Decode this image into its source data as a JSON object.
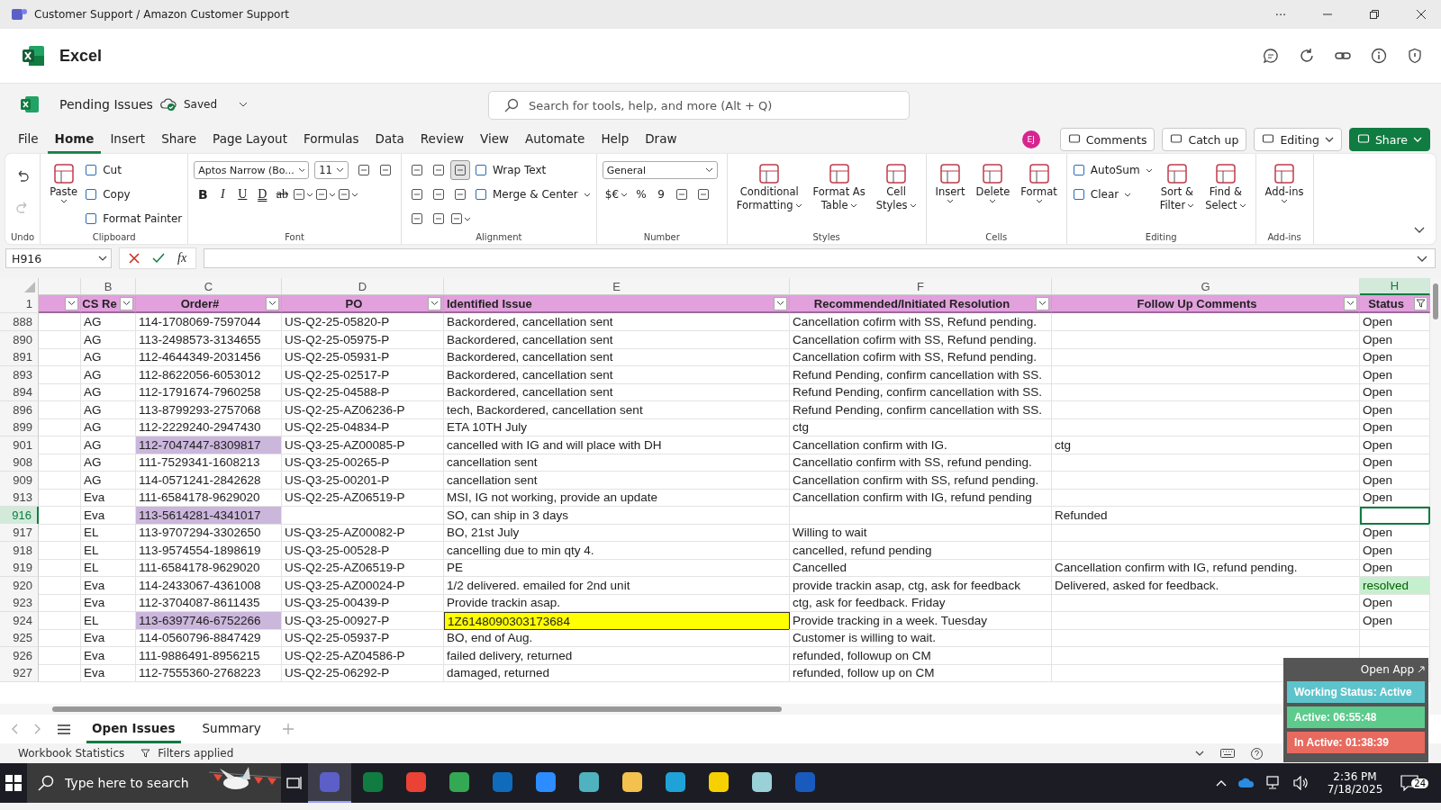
{
  "title_bar": {
    "title": "Customer Support / Amazon Customer Support",
    "more": "···"
  },
  "app": {
    "name": "Excel"
  },
  "document": {
    "name": "Pending Issues",
    "save_state": "Saved"
  },
  "search": {
    "placeholder": "Search for tools, help, and more (Alt + Q)"
  },
  "menu_tabs": [
    {
      "label": "File",
      "selected": false
    },
    {
      "label": "Home",
      "selected": true
    },
    {
      "label": "Insert",
      "selected": false
    },
    {
      "label": "Share",
      "selected": false
    },
    {
      "label": "Page Layout",
      "selected": false
    },
    {
      "label": "Formulas",
      "selected": false
    },
    {
      "label": "Data",
      "selected": false
    },
    {
      "label": "Review",
      "selected": false
    },
    {
      "label": "View",
      "selected": false
    },
    {
      "label": "Automate",
      "selected": false
    },
    {
      "label": "Help",
      "selected": false
    },
    {
      "label": "Draw",
      "selected": false
    }
  ],
  "user": {
    "initials": "EJ"
  },
  "actions": [
    {
      "label": "Comments",
      "kind": "plain"
    },
    {
      "label": "Catch up",
      "kind": "plain"
    },
    {
      "label": "Editing",
      "kind": "menu"
    },
    {
      "label": "Share",
      "kind": "primary"
    }
  ],
  "ribbon": [
    {
      "label": "Undo",
      "columns": [
        [
          {
            "kind": "icon",
            "disabled": false
          },
          {
            "kind": "icon",
            "disabled": true
          }
        ]
      ]
    },
    {
      "label": "Clipboard",
      "columns": [
        [
          {
            "kind": "large",
            "lines": [
              "Paste"
            ],
            "menu": true
          }
        ],
        [
          {
            "kind": "row",
            "label": "Cut"
          },
          {
            "kind": "row",
            "label": "Copy"
          },
          {
            "kind": "row",
            "label": "Format Painter"
          }
        ]
      ]
    },
    {
      "label": "Font",
      "columns": [
        [
          {
            "kind": "strip",
            "items": [
              {
                "kind": "dropdown",
                "label": "Aptos Narrow (Bo...",
                "wide": true
              },
              {
                "kind": "dropdown",
                "label": "11",
                "wide": false
              },
              {
                "kind": "icon"
              },
              {
                "kind": "icon"
              }
            ]
          },
          {
            "kind": "strip",
            "items": [
              {
                "kind": "bold",
                "label": "B"
              },
              {
                "kind": "italic",
                "label": "I"
              },
              {
                "kind": "underline",
                "label": "U"
              },
              {
                "kind": "double",
                "label": "D"
              },
              {
                "kind": "strike",
                "label": "ab"
              },
              {
                "kind": "icon",
                "menu": true
              },
              {
                "kind": "icon",
                "menu": true
              },
              {
                "kind": "icon",
                "menu": true
              }
            ]
          }
        ]
      ]
    },
    {
      "label": "Alignment",
      "columns": [
        [
          {
            "kind": "strip",
            "items": [
              {
                "kind": "icon",
                "selected": false
              },
              {
                "kind": "icon",
                "selected": false
              },
              {
                "kind": "icon",
                "selected": true
              }
            ]
          },
          {
            "kind": "strip",
            "items": [
              {
                "kind": "icon"
              },
              {
                "kind": "icon"
              },
              {
                "kind": "icon"
              }
            ]
          },
          {
            "kind": "strip",
            "items": [
              {
                "kind": "icon"
              },
              {
                "kind": "icon"
              },
              {
                "kind": "icon",
                "menu": true
              }
            ]
          }
        ],
        [
          {
            "kind": "row",
            "label": "Wrap Text"
          },
          {
            "kind": "row",
            "label": "Merge & Center",
            "menu": true
          }
        ]
      ]
    },
    {
      "label": "Number",
      "columns": [
        [
          {
            "kind": "strip",
            "items": [
              {
                "kind": "dropdown",
                "label": "General",
                "wide": true
              }
            ]
          },
          {
            "kind": "strip",
            "items": [
              {
                "kind": "glyph",
                "label": "$€",
                "menu": true
              },
              {
                "kind": "glyph",
                "label": "%"
              },
              {
                "kind": "glyph",
                "label": "9"
              },
              {
                "kind": "icon"
              },
              {
                "kind": "icon"
              }
            ]
          }
        ]
      ]
    },
    {
      "label": "Styles",
      "columns": [
        [
          {
            "kind": "large",
            "lines": [
              "Conditional",
              "Formatting"
            ],
            "menu": true
          }
        ],
        [
          {
            "kind": "large",
            "lines": [
              "Format As",
              "Table"
            ],
            "menu": true
          }
        ],
        [
          {
            "kind": "large",
            "lines": [
              "Cell",
              "Styles"
            ],
            "menu": true
          }
        ]
      ]
    },
    {
      "label": "Cells",
      "columns": [
        [
          {
            "kind": "large",
            "lines": [
              "Insert"
            ],
            "menu": true
          }
        ],
        [
          {
            "kind": "large",
            "lines": [
              "Delete"
            ],
            "menu": true
          }
        ],
        [
          {
            "kind": "large",
            "lines": [
              "Format"
            ],
            "menu": true
          }
        ]
      ]
    },
    {
      "label": "Editing",
      "columns": [
        [
          {
            "kind": "row",
            "label": "AutoSum",
            "menu": true
          },
          {
            "kind": "row",
            "label": "Clear",
            "menu": true
          }
        ],
        [
          {
            "kind": "large",
            "lines": [
              "Sort &",
              "Filter"
            ],
            "menu": true
          }
        ],
        [
          {
            "kind": "large",
            "lines": [
              "Find &",
              "Select"
            ],
            "menu": true
          }
        ]
      ]
    },
    {
      "label": "Add-ins",
      "columns": [
        [
          {
            "kind": "large",
            "lines": [
              "Add-ins"
            ],
            "menu": true
          }
        ]
      ]
    }
  ],
  "formula_bar": {
    "cell": "H916",
    "fx": "fx"
  },
  "sheet": {
    "columns": [
      {
        "selected": false
      },
      {
        "letter": "B",
        "selected": false
      },
      {
        "letter": "C",
        "selected": false
      },
      {
        "letter": "D",
        "selected": false
      },
      {
        "letter": "E",
        "selected": false
      },
      {
        "letter": "F",
        "selected": false
      },
      {
        "letter": "G",
        "selected": false
      },
      {
        "letter": "H",
        "selected": true
      }
    ],
    "header_row": "1",
    "header": [
      {
        "filter_applied": false
      },
      {
        "label": "CS Re",
        "filter_applied": false
      },
      {
        "label": "Order#",
        "filter_applied": false
      },
      {
        "label": "PO",
        "filter_applied": false
      },
      {
        "label": "Identified Issue",
        "filter_applied": false
      },
      {
        "label": "Recommended/Initiated Resolution",
        "filter_applied": false
      },
      {
        "label": "Follow Up Comments",
        "filter_applied": false
      },
      {
        "label": "Status",
        "filter_applied": true
      }
    ],
    "rows": [
      {
        "num": "888",
        "selected": false,
        "cells": {
          "b": "AG",
          "c": "114-1708069-7597044",
          "d": "US-Q2-25-05820-P",
          "e": "Backordered, cancellation sent",
          "f": "Cancellation cofirm with SS, Refund pending.",
          "h": "Open"
        }
      },
      {
        "num": "890",
        "selected": false,
        "cells": {
          "b": "AG",
          "c": "113-2498573-3134655",
          "d": "US-Q2-25-05975-P",
          "e": "Backordered, cancellation sent",
          "f": "Cancellation cofirm with SS, Refund pending.",
          "h": "Open"
        }
      },
      {
        "num": "891",
        "selected": false,
        "cells": {
          "b": "AG",
          "c": "112-4644349-2031456",
          "d": "US-Q2-25-05931-P",
          "e": "Backordered, cancellation sent",
          "f": "Cancellation cofirm with SS, Refund pending.",
          "h": "Open"
        }
      },
      {
        "num": "893",
        "selected": false,
        "cells": {
          "b": "AG",
          "c": "112-8622056-6053012",
          "d": "US-Q2-25-02517-P",
          "e": "Backordered, cancellation sent",
          "f": "Refund Pending, confirm cancellation with SS.",
          "h": "Open"
        }
      },
      {
        "num": "894",
        "selected": false,
        "cells": {
          "b": "AG",
          "c": "112-1791674-7960258",
          "d": "US-Q2-25-04588-P",
          "e": "Backordered, cancellation sent",
          "f": "Refund Pending, confirm cancellation with SS.",
          "h": "Open"
        }
      },
      {
        "num": "896",
        "selected": false,
        "cells": {
          "b": "AG",
          "c": "113-8799293-2757068",
          "d": "US-Q2-25-AZ06236-P",
          "e": "tech, Backordered, cancellation sent",
          "f": "Refund Pending, confirm cancellation with SS.",
          "h": "Open"
        }
      },
      {
        "num": "899",
        "selected": false,
        "cells": {
          "b": "AG",
          "c": "112-2229240-2947430",
          "d": "US-Q2-25-04834-P",
          "e": "ETA 10TH July",
          "f": "ctg",
          "h": "Open"
        }
      },
      {
        "num": "901",
        "selected": false,
        "cells": {
          "b": "AG",
          "c": "112-7047447-8309817",
          "d": "US-Q3-25-AZ00085-P",
          "e": "cancelled with IG and will place with DH",
          "f": "Cancellation confirm with IG.",
          "g": "ctg",
          "h": "Open"
        },
        "fills": {
          "c": {
            "color": "#cbb6dc"
          }
        }
      },
      {
        "num": "908",
        "selected": false,
        "cells": {
          "b": "AG",
          "c": "111-7529341-1608213",
          "d": "US-Q3-25-00265-P",
          "e": "cancellation sent",
          "f": "Cancellatio confirm with SS, refund pending.",
          "h": "Open"
        }
      },
      {
        "num": "909",
        "selected": false,
        "cells": {
          "b": "AG",
          "c": "114-0571241-2842628",
          "d": "US-Q3-25-00201-P",
          "e": "cancellation sent",
          "f": "Cancellation confirm with SS, refund pending.",
          "h": "Open"
        }
      },
      {
        "num": "913",
        "selected": false,
        "cells": {
          "b": "Eva",
          "c": "111-6584178-9629020",
          "d": "US-Q2-25-AZ06519-P",
          "e": "MSI, IG not working, provide an update",
          "f": "Cancellation confirm with IG, refund pending",
          "h": "Open"
        }
      },
      {
        "num": "916",
        "selected": true,
        "cells": {
          "b": "Eva",
          "c": "113-5614281-4341017",
          "e": "SO, can ship in 3 days",
          "g": "Refunded"
        },
        "fills": {
          "c": {
            "color": "#cbb6dc"
          }
        }
      },
      {
        "num": "917",
        "selected": false,
        "cells": {
          "b": "EL",
          "c": "113-9707294-3302650",
          "d": "US-Q3-25-AZ00082-P",
          "e": "BO, 21st July",
          "f": "Willing to wait",
          "h": "Open"
        }
      },
      {
        "num": "918",
        "selected": false,
        "cells": {
          "b": "EL",
          "c": "113-9574554-1898619",
          "d": "US-Q3-25-00528-P",
          "e": "cancelling due to min qty 4.",
          "f": "cancelled, refund pending",
          "h": "Open"
        }
      },
      {
        "num": "919",
        "selected": false,
        "cells": {
          "b": "EL",
          "c": "111-6584178-9629020",
          "d": "US-Q2-25-AZ06519-P",
          "e": "PE",
          "f": "Cancelled",
          "g": "Cancellation confirm with IG, refund pending.",
          "h": "Open"
        }
      },
      {
        "num": "920",
        "selected": false,
        "cells": {
          "b": "Eva",
          "c": "114-2433067-4361008",
          "d": "US-Q3-25-AZ00024-P",
          "e": "1/2 delivered. emailed for 2nd unit",
          "f": "provide trackin asap, ctg, ask for feedback",
          "g": "Delivered, asked for feedback.",
          "h": "resolved"
        },
        "fills": {
          "h": {
            "color": "#c6efce"
          }
        }
      },
      {
        "num": "923",
        "selected": false,
        "cells": {
          "b": "Eva",
          "c": "112-3704087-8611435",
          "d": "US-Q3-25-00439-P",
          "e": "Provide trackin asap.",
          "f": "ctg, ask for feedback. Friday",
          "h": "Open"
        }
      },
      {
        "num": "924",
        "selected": false,
        "cells": {
          "b": "EL",
          "c": "113-6397746-6752266",
          "d": "US-Q3-25-00927-P",
          "e": "1Z6148090303173684",
          "f": "Provide tracking in a week. Tuesday",
          "h": "Open"
        },
        "fills": {
          "c": {
            "color": "#cbb6dc"
          },
          "e": {
            "color": "#ffff00"
          }
        }
      },
      {
        "num": "925",
        "selected": false,
        "cells": {
          "b": "Eva",
          "c": "114-0560796-8847429",
          "d": "US-Q2-25-05937-P",
          "e": "BO, end of Aug.",
          "f": "Customer is willing to wait."
        }
      },
      {
        "num": "926",
        "selected": false,
        "cells": {
          "b": "Eva",
          "c": "111-9886491-8956215",
          "d": "US-Q2-25-AZ04586-P",
          "e": "failed delivery, returned",
          "f": "refunded, followup on CM"
        }
      },
      {
        "num": "927",
        "selected": false,
        "cells": {
          "b": "Eva",
          "c": "112-7555360-2768223",
          "d": "US-Q2-25-06292-P",
          "e": "damaged, returned",
          "f": "refunded, follow up on CM"
        }
      }
    ]
  },
  "sheet_tabs": [
    {
      "label": "Open Issues",
      "selected": true
    },
    {
      "label": "Summary",
      "selected": false
    }
  ],
  "status_bar": {
    "stats": "Workbook Statistics",
    "filters": "Filters applied"
  },
  "tracker": {
    "link": "Open App",
    "timers": [
      {
        "text": "Working Status: Active",
        "color": "#5ec4cc"
      },
      {
        "text": "Active: 06:55:48",
        "color": "#5ccb8c"
      },
      {
        "text": "In Active: 01:38:39",
        "color": "#e86a5e"
      }
    ]
  },
  "taskbar": {
    "search_placeholder": "Type here to search",
    "apps": [
      {
        "color": "#5b5fc7",
        "selected": true
      },
      {
        "color": "#107c41",
        "selected": false
      },
      {
        "color": "#ea4335",
        "selected": false
      },
      {
        "color": "#34a853",
        "selected": false
      },
      {
        "color": "#0f6cbd",
        "selected": false
      },
      {
        "color": "#2d8cff",
        "selected": false
      },
      {
        "color": "#4fb3bf",
        "selected": false
      },
      {
        "color": "#f2c14e",
        "selected": false
      },
      {
        "color": "#1fa2d8",
        "selected": false
      },
      {
        "color": "#f7d000",
        "selected": false
      },
      {
        "color": "#9ad0d8",
        "selected": false
      },
      {
        "color": "#185abd",
        "selected": false
      }
    ],
    "time": "2:36 PM",
    "date": "7/18/2025",
    "notifications": "24"
  }
}
